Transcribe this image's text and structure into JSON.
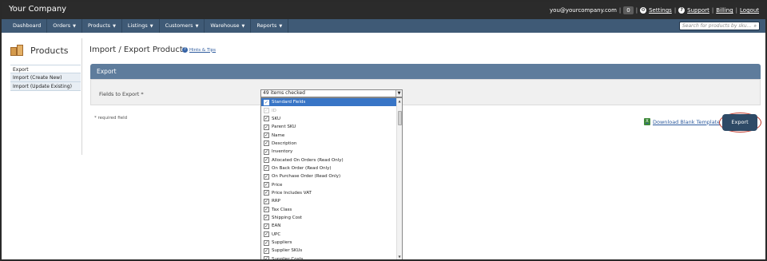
{
  "header": {
    "brand": "Your Company",
    "email": "you@yourcompany.com",
    "count": "0",
    "settings": "Settings",
    "support": "Support",
    "billing": "Billing",
    "logout": "Logout"
  },
  "nav": {
    "items": [
      "Dashboard",
      "Orders",
      "Products",
      "Listings",
      "Customers",
      "Warehouse",
      "Reports"
    ],
    "search_placeholder": "Search for products by sku..."
  },
  "sidebar": {
    "title": "Products",
    "items": [
      "Export",
      "Import (Create New)",
      "Import (Update Existing)"
    ]
  },
  "main": {
    "title": "Import / Export Products",
    "hints": "Hints & Tips",
    "panel_title": "Export",
    "field_label": "Fields to Export *",
    "select_value": "49 items checked",
    "required_note": "* required field",
    "download_link": "Download Blank Template",
    "export_button": "Export"
  },
  "dropdown": {
    "items": [
      {
        "label": "Standard Fields",
        "checked": true,
        "header": true
      },
      {
        "label": "ID",
        "checked": true,
        "disabled": true
      },
      {
        "label": "SKU",
        "checked": true
      },
      {
        "label": "Parent SKU",
        "checked": true
      },
      {
        "label": "Name",
        "checked": true
      },
      {
        "label": "Description",
        "checked": true
      },
      {
        "label": "Inventory",
        "checked": true
      },
      {
        "label": "Allocated On Orders (Read Only)",
        "checked": true
      },
      {
        "label": "On Back Order (Read Only)",
        "checked": true
      },
      {
        "label": "On Purchase Order (Read Only)",
        "checked": true
      },
      {
        "label": "Price",
        "checked": true
      },
      {
        "label": "Price Includes VAT",
        "checked": true
      },
      {
        "label": "RRP",
        "checked": true
      },
      {
        "label": "Tax Class",
        "checked": true
      },
      {
        "label": "Shipping Cost",
        "checked": true
      },
      {
        "label": "EAN",
        "checked": true
      },
      {
        "label": "UPC",
        "checked": true
      },
      {
        "label": "Suppliers",
        "checked": true
      },
      {
        "label": "Supplier SKUs",
        "checked": true
      },
      {
        "label": "Supplier Costs",
        "checked": true
      }
    ]
  },
  "colors": {
    "topbar": "#2b2b2b",
    "navbar": "#3f5a76",
    "panel_header": "#5e7c9c",
    "export_button": "#2e4a66",
    "highlight_ring": "#c0392b",
    "selected_row": "#3875c6"
  }
}
